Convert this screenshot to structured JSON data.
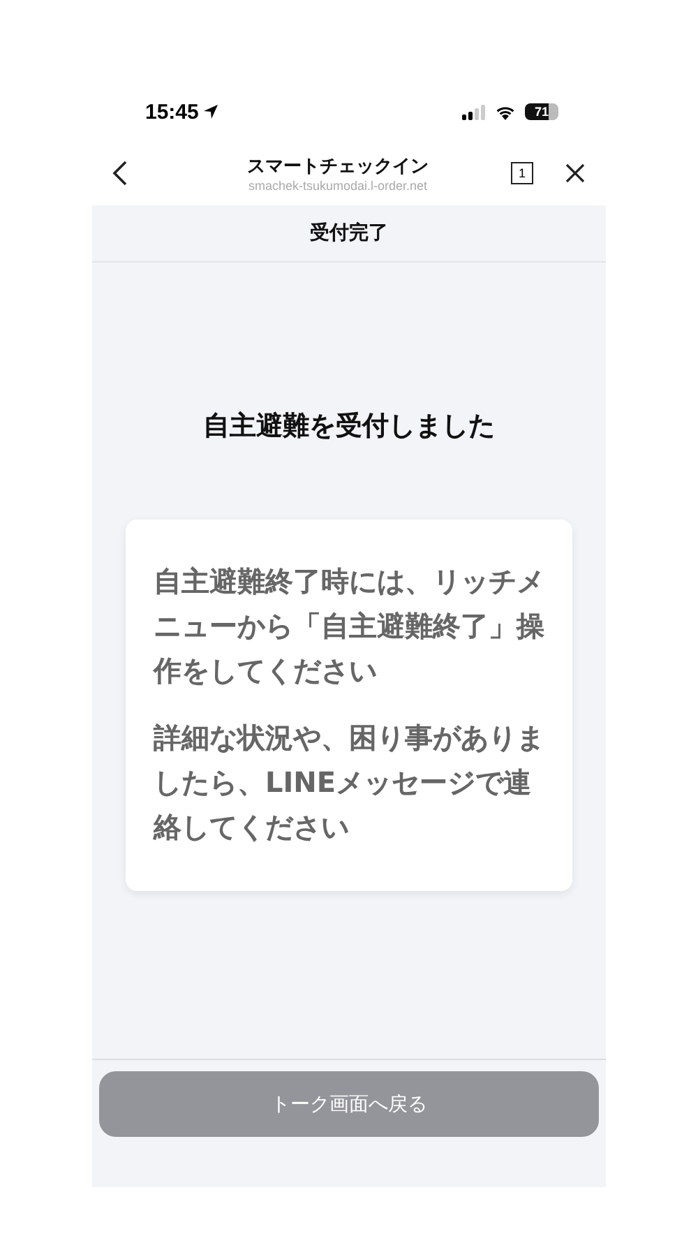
{
  "status_bar": {
    "time": "15:45",
    "battery": "71"
  },
  "browser_header": {
    "title": "スマートチェックイン",
    "url": "smachek-tsukumodai.l-order.net",
    "tab_count": "1"
  },
  "page_header": {
    "title": "受付完了"
  },
  "heading": "自主避難を受付しました",
  "card": {
    "paragraphs": [
      "自主避難終了時には、リッチメニューから「自主避難終了」操作をしてください",
      "詳細な状況や、困り事がありましたら、LINEメッセージで連絡してください"
    ]
  },
  "footer": {
    "button": "トーク画面へ戻る"
  }
}
